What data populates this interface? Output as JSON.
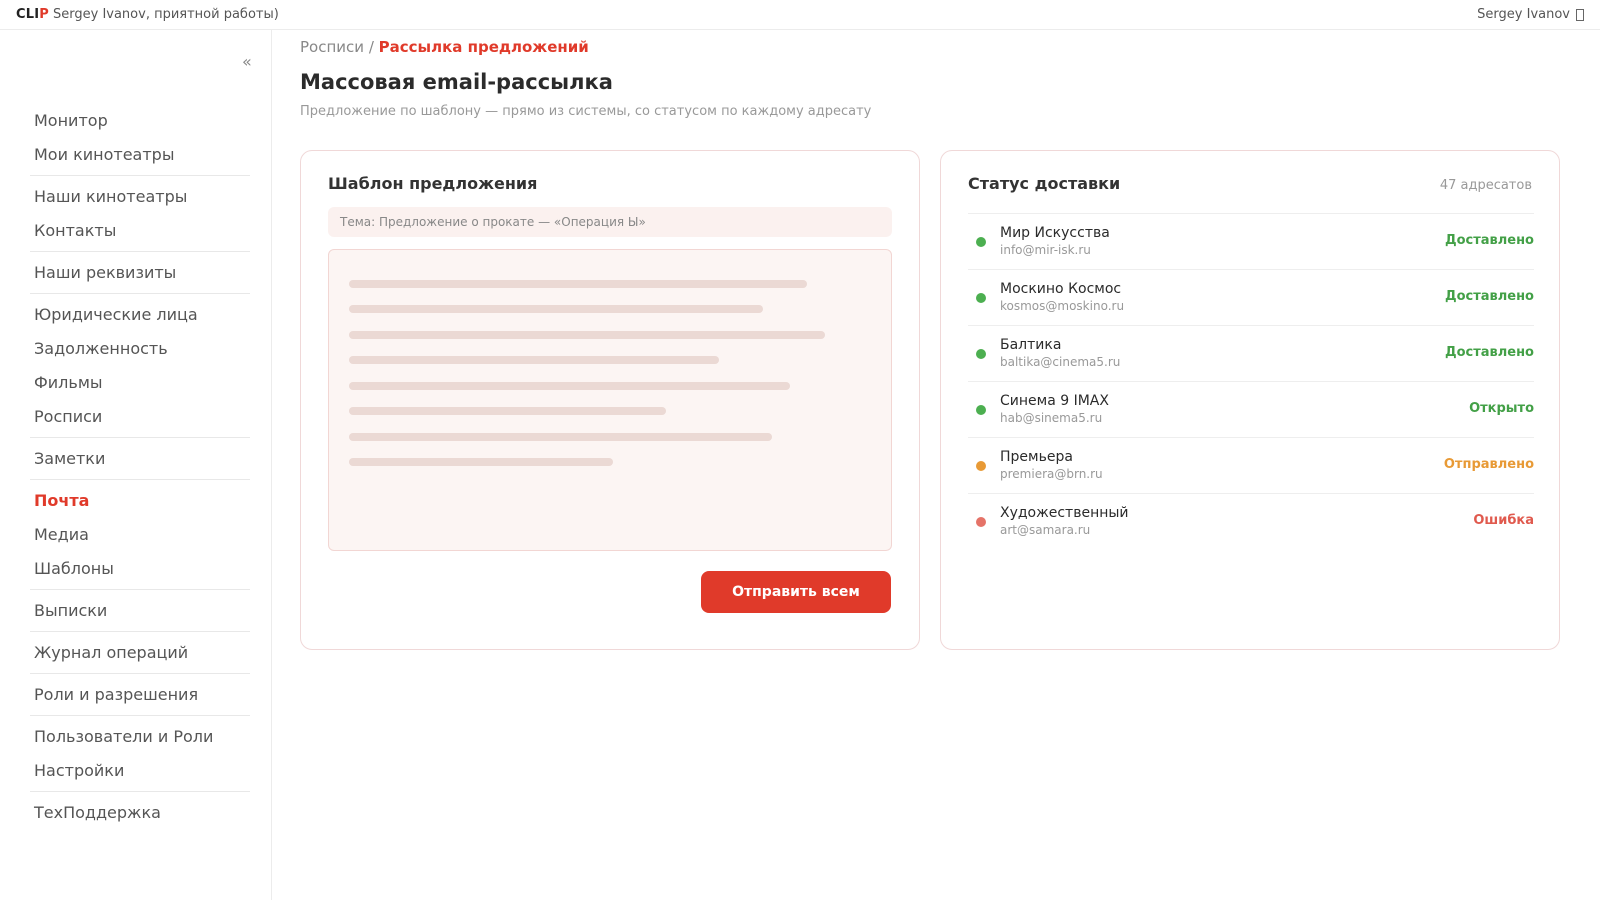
{
  "topbar": {
    "logo_main": "CLI",
    "logo_accent": "P",
    "greeting": "Sergey Ivanov, приятной работы)",
    "user_name": "Sergey Ivanov"
  },
  "sidebar": {
    "collapse_icon": "«",
    "groups": [
      [
        "Монитор",
        "Мои кинотеатры"
      ],
      [
        "Наши кинотеатры",
        "Контакты"
      ],
      [
        "Наши реквизиты"
      ],
      [
        "Юридические лица",
        "Задолженность",
        "Фильмы",
        "Росписи"
      ],
      [
        "Заметки"
      ],
      [
        "Почта",
        "Медиа",
        "Шаблоны"
      ],
      [
        "Выписки"
      ],
      [
        "Журнал операций"
      ],
      [
        "Роли и разрешения"
      ],
      [
        "Пользователи и Роли",
        "Настройки"
      ],
      [
        "ТехПоддержка"
      ]
    ],
    "active_item": "Почта"
  },
  "breadcrumb": {
    "parent": "Росписи",
    "separator": "/",
    "current": "Рассылка предложений"
  },
  "page": {
    "title": "Массовая email-рассылка",
    "subtitle": "Предложение по шаблону — прямо из системы, со статусом по каждому адресату"
  },
  "template_card": {
    "title": "Шаблон предложения",
    "subject": "Тема: Предложение о прокате — «Операция Ы»",
    "send_button": "Отправить всем"
  },
  "status_card": {
    "title": "Статус доставки",
    "count": "47 адресатов",
    "recipients": [
      {
        "name": "Мир Искусства",
        "email": "info@mir-isk.ru",
        "status": "Доставлено",
        "color": "#4caf50",
        "status_color": "#43a047"
      },
      {
        "name": "Москино Космос",
        "email": "kosmos@moskino.ru",
        "status": "Доставлено",
        "color": "#4caf50",
        "status_color": "#43a047"
      },
      {
        "name": "Балтика",
        "email": "baltika@cinema5.ru",
        "status": "Доставлено",
        "color": "#4caf50",
        "status_color": "#43a047"
      },
      {
        "name": "Синема 9 IMAX",
        "email": "hab@sinema5.ru",
        "status": "Открыто",
        "color": "#4caf50",
        "status_color": "#43a047"
      },
      {
        "name": "Премьера",
        "email": "premiera@brn.ru",
        "status": "Отправлено",
        "color": "#e89a36",
        "status_color": "#e89a36"
      },
      {
        "name": "Художественный",
        "email": "art@samara.ru",
        "status": "Ошибка",
        "color": "#e57368",
        "status_color": "#e05a4e"
      }
    ]
  },
  "colors": {
    "accent": "#e03a2a",
    "delivered": "#43a047",
    "sent": "#e89a36",
    "error": "#e05a4e"
  }
}
